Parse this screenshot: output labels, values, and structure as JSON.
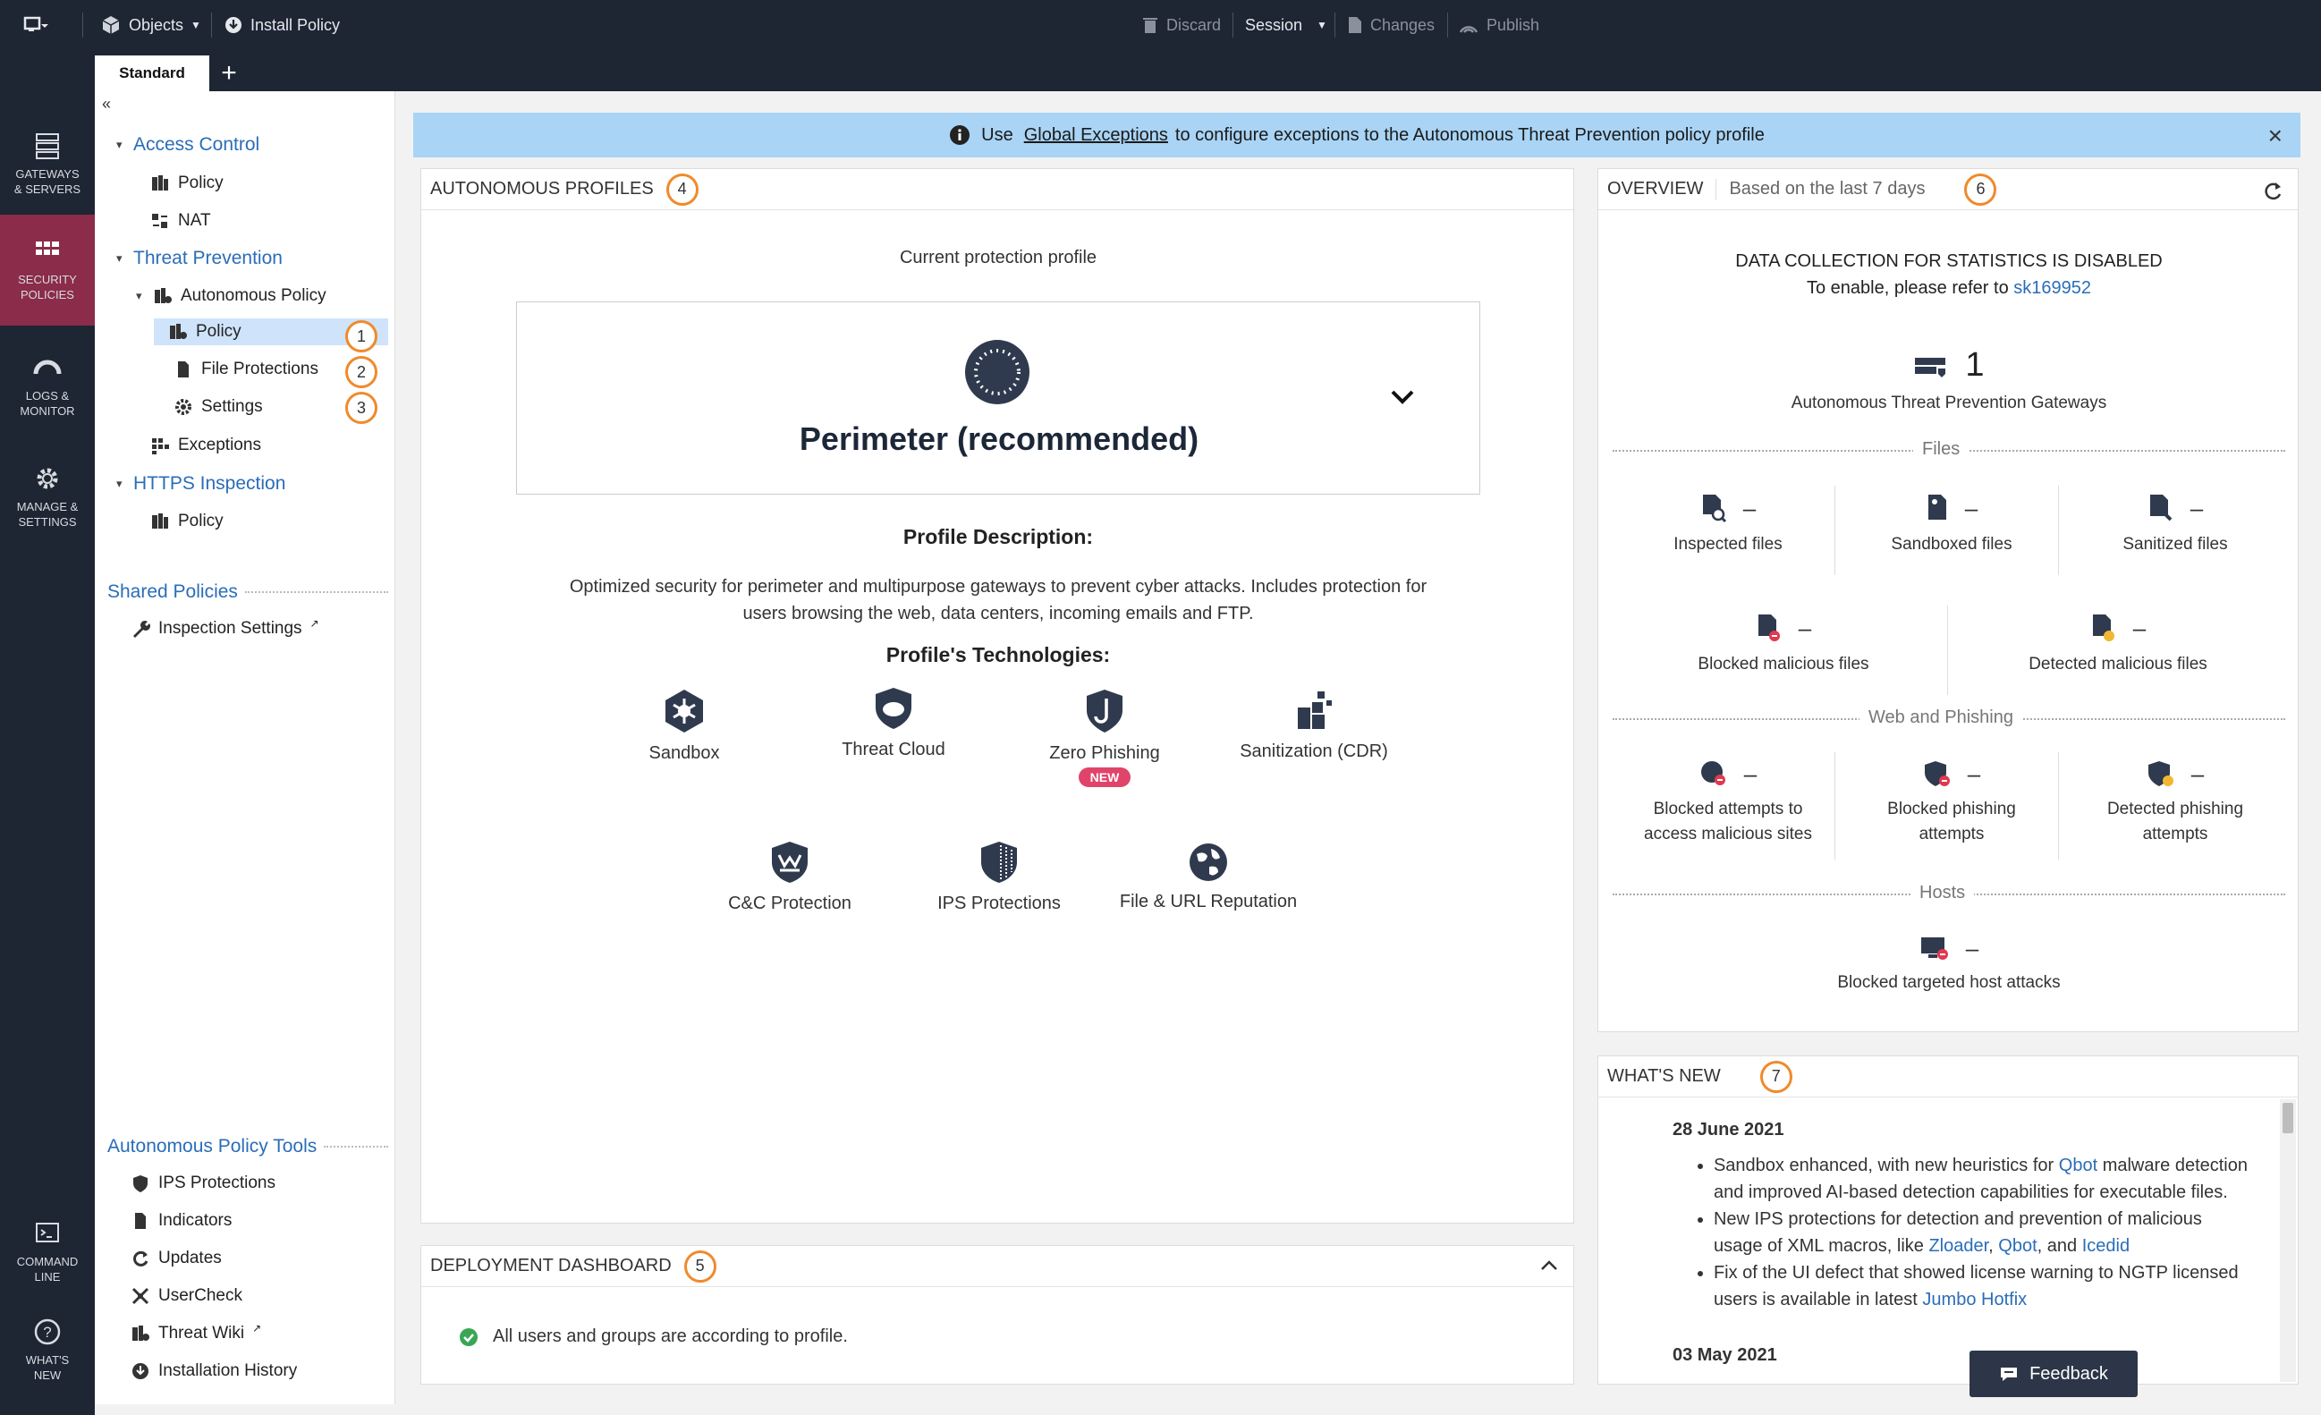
{
  "topbar": {
    "objects": "Objects",
    "install_policy": "Install Policy",
    "discard": "Discard",
    "session": "Session",
    "changes": "Changes",
    "publish": "Publish"
  },
  "tabs": {
    "active": "Standard",
    "add": "+"
  },
  "leftnav": [
    {
      "label1": "GATEWAYS",
      "label2": "& SERVERS"
    },
    {
      "label1": "SECURITY",
      "label2": "POLICIES"
    },
    {
      "label1": "LOGS &",
      "label2": "MONITOR"
    },
    {
      "label1": "MANAGE &",
      "label2": "SETTINGS"
    },
    {
      "label1": "COMMAND",
      "label2": "LINE"
    },
    {
      "label1": "WHAT'S",
      "label2": "NEW"
    }
  ],
  "tree": {
    "collapse": "«",
    "access_control": "Access Control",
    "ac_policy": "Policy",
    "ac_nat": "NAT",
    "threat_prevention": "Threat Prevention",
    "autonomous_policy": "Autonomous Policy",
    "tp_policy": "Policy",
    "file_protections": "File Protections",
    "settings": "Settings",
    "exceptions": "Exceptions",
    "https_inspection": "HTTPS Inspection",
    "https_policy": "Policy",
    "shared_policies": "Shared Policies",
    "inspection_settings": "Inspection Settings",
    "tools_header": "Autonomous Policy Tools",
    "tools": [
      "IPS Protections",
      "Indicators",
      "Updates",
      "UserCheck",
      "Threat Wiki",
      "Installation History"
    ]
  },
  "markers": [
    "1",
    "2",
    "3",
    "4",
    "5",
    "6",
    "7"
  ],
  "banner": {
    "pre": "Use",
    "link": "Global Exceptions",
    "post": "to configure exceptions to the Autonomous Threat Prevention policy profile",
    "close": "×"
  },
  "profiles": {
    "title": "AUTONOMOUS PROFILES",
    "current_label": "Current protection profile",
    "profile_name": "Perimeter (recommended)",
    "desc_title": "Profile Description:",
    "desc_line1": "Optimized security for perimeter and multipurpose gateways to prevent cyber attacks. Includes protection for",
    "desc_line2": "users browsing the web, data centers, incoming emails and FTP.",
    "tech_title": "Profile's Technologies:",
    "technologies": [
      "Sandbox",
      "Threat Cloud",
      "Zero Phishing",
      "Sanitization (CDR)",
      "C&C Protection",
      "IPS Protections",
      "File & URL Reputation"
    ],
    "new_badge": "NEW"
  },
  "deployment": {
    "title": "DEPLOYMENT DASHBOARD",
    "message": "All users and groups are according to profile."
  },
  "overview": {
    "title": "OVERVIEW",
    "subtitle": "Based on the last 7 days",
    "disabled_title": "DATA COLLECTION FOR STATISTICS IS DISABLED",
    "enable_pre": "To enable, please refer to",
    "enable_link": "sk169952",
    "gateways_count": "1",
    "gateways_label": "Autonomous Threat Prevention Gateways",
    "sections": [
      "Files",
      "Web and Phishing",
      "Hosts"
    ],
    "dash": "–",
    "files": [
      "Inspected files",
      "Sandboxed files",
      "Sanitized files",
      "Blocked malicious files",
      "Detected malicious files"
    ],
    "web": [
      {
        "l1": "Blocked attempts to",
        "l2": "access malicious sites"
      },
      {
        "l1": "Blocked phishing",
        "l2": "attempts"
      },
      {
        "l1": "Detected phishing",
        "l2": "attempts"
      }
    ],
    "hosts": [
      "Blocked targeted host attacks"
    ]
  },
  "whatsnew": {
    "title": "WHAT'S NEW",
    "date1": "28 June 2021",
    "b1_pre": "Sandbox enhanced, with new heuristics for",
    "b1_link": "Qbot",
    "b1_post": "malware detection",
    "b1_line2": "and improved AI-based detection capabilities for executable files.",
    "b2_line1": "New IPS protections for detection and prevention of malicious",
    "b2_pre": "usage of XML macros, like",
    "b2_link1": "Zloader",
    "b2_link2": "Qbot",
    "b2_and": ", and",
    "b2_link3": "Icedid",
    "b3_line1": "Fix of the UI defect that showed license warning to NGTP licensed",
    "b3_pre": "users is available in latest",
    "b3_link": "Jumbo Hotfix",
    "date2": "03 May 2021"
  },
  "feedback": "Feedback",
  "colors": {
    "accent": "#f08a2c",
    "link": "#2a6db8",
    "nav_bg": "#1e2533",
    "active_nav": "#8a2c4a",
    "banner": "#a9d4f5"
  }
}
